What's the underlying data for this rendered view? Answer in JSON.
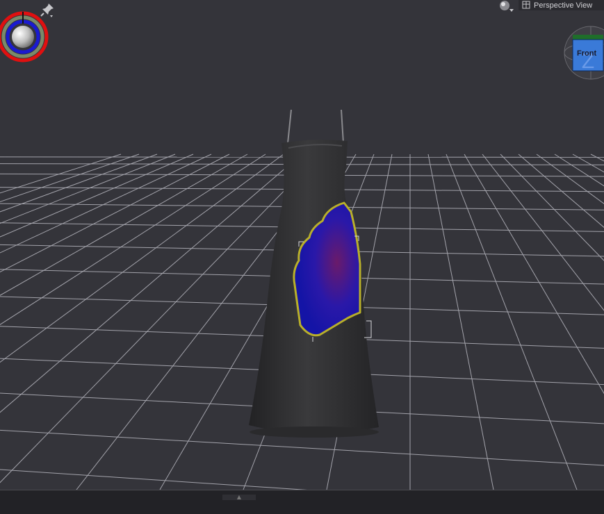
{
  "viewport": {
    "view_name": "Perspective View",
    "cube_face_label": "Front"
  },
  "icons": {
    "pin": "pin-icon",
    "shading": "shading-mode-icon",
    "view": "camera-view-icon",
    "light": "light-direction-gizmo",
    "cube": "view-cube"
  },
  "colors": {
    "viewport_bg": "#34343a",
    "grid": "#bdbdc4",
    "dress": "#2e2e30",
    "paint_blue": "#1a1aa8",
    "paint_outline": "#b9b02a",
    "cube_blue": "#3a7ad8"
  }
}
